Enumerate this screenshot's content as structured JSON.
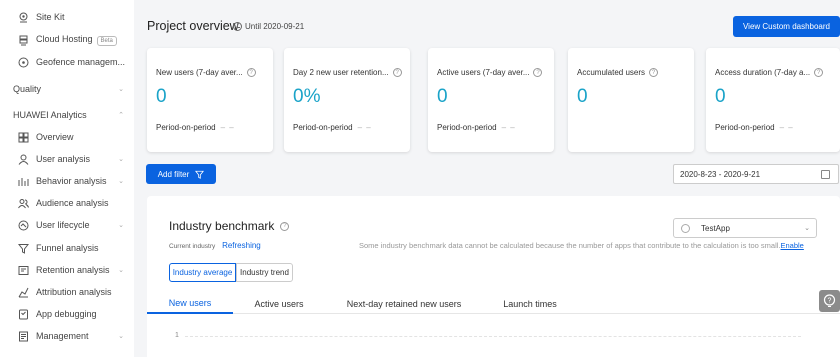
{
  "sidebar": {
    "items": [
      {
        "label": "Site Kit",
        "icon": "location-pin-icon",
        "chevron": false
      },
      {
        "label": "Cloud Hosting",
        "icon": "server-icon",
        "badge": "Beta",
        "chevron": false
      },
      {
        "label": "Geofence managem...",
        "icon": "geofence-icon",
        "chevron": false
      },
      {
        "label": "Quality",
        "top": true,
        "chevron": true
      },
      {
        "label": "HUAWEI Analytics",
        "top": true,
        "chevron": true,
        "expanded": true
      },
      {
        "label": "Overview",
        "icon": "grid-icon",
        "chevron": false
      },
      {
        "label": "User analysis",
        "icon": "user-icon",
        "chevron": true
      },
      {
        "label": "Behavior analysis",
        "icon": "behavior-chart-icon",
        "chevron": true
      },
      {
        "label": "Audience analysis",
        "icon": "audience-icon",
        "chevron": false
      },
      {
        "label": "User lifecycle",
        "icon": "lifecycle-icon",
        "chevron": true
      },
      {
        "label": "Funnel analysis",
        "icon": "funnel-icon",
        "chevron": false
      },
      {
        "label": "Retention analysis",
        "icon": "retention-icon",
        "chevron": true
      },
      {
        "label": "Attribution analysis",
        "icon": "attribution-icon",
        "chevron": false
      },
      {
        "label": "App debugging",
        "icon": "debug-icon",
        "chevron": false
      },
      {
        "label": "Management",
        "icon": "management-icon",
        "chevron": true
      }
    ]
  },
  "header": {
    "title": "Project overview",
    "until": "Until 2020-09-21",
    "custom_dashboard_button": "View Custom dashboard"
  },
  "cards": [
    {
      "title": "New users (7-day aver...",
      "value": "0",
      "footer": "Period-on-period",
      "dash": "– –"
    },
    {
      "title": "Day 2 new user retention...",
      "value": "0%",
      "footer": "Period-on-period",
      "dash": "– –"
    },
    {
      "title": "Active users (7-day aver...",
      "value": "0",
      "footer": "Period-on-period",
      "dash": "– –"
    },
    {
      "title": "Accumulated users",
      "value": "0",
      "footer": "",
      "dash": ""
    },
    {
      "title": "Access duration (7-day a...",
      "value": "0",
      "footer": "Period-on-period",
      "dash": "– –"
    }
  ],
  "filter": {
    "add_filter_label": "Add filter",
    "date_range": "2020-8-23 - 2020-9-21"
  },
  "benchmark": {
    "title": "Industry benchmark",
    "current_industry_label": "Current industry",
    "current_industry_value": "Refreshing",
    "app_select_value": "TestApp",
    "notice": "Some industry benchmark data cannot be calculated because the number of apps that contribute to the calculation is too small.",
    "enable_link": "Enable",
    "toggle_average": "Industry average",
    "toggle_trend": "Industry trend",
    "tabs": [
      "New users",
      "Active users",
      "Next-day retained new users",
      "Launch times"
    ],
    "y_tick": "1"
  },
  "colors": {
    "accent": "#0a63e0",
    "metric": "#1aa3c8"
  }
}
